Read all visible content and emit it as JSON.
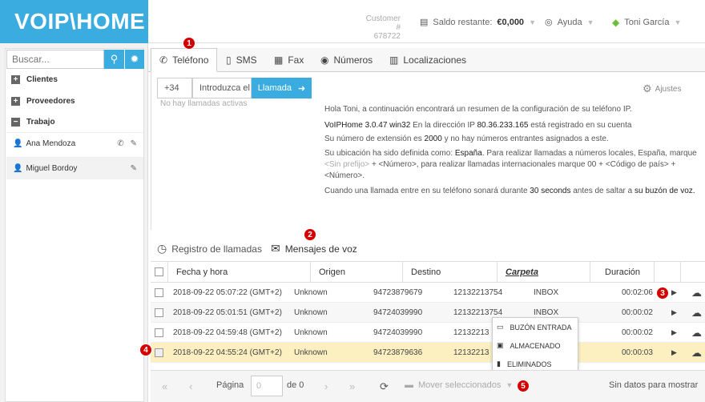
{
  "app": {
    "logo": "VOIP\\HOME"
  },
  "header": {
    "customer_label": "Customer #",
    "customer_number": "678722",
    "saldo_label": "Saldo restante:",
    "saldo_value": "€0,000",
    "help": "Ayuda",
    "user": "Toni García"
  },
  "sidebar": {
    "search_placeholder": "Buscar...",
    "groups": [
      {
        "label": "Clientes",
        "sign": "+"
      },
      {
        "label": "Proveedores",
        "sign": "+"
      },
      {
        "label": "Trabajo",
        "sign": "−"
      }
    ],
    "contacts": [
      "Ana Mendoza",
      "Miguel Bordoy"
    ]
  },
  "tabs": [
    "Teléfono",
    "SMS",
    "Fax",
    "Números",
    "Localizaciones"
  ],
  "dialer": {
    "prefix": "+34",
    "number_placeholder": "Introduzca el número",
    "call_label": "Llamada",
    "no_calls": "No hay llamadas activas",
    "settings": "Ajustes"
  },
  "info": {
    "greeting": "Hola Toni, a continuación encontrará un resumen de la configuración de su teléfono IP.",
    "version": "VoIPHome 3.0.47 win32",
    "ip_text": "En la dirección IP",
    "ip": "80.36.233.165",
    "registered": "está registrado en su cuenta",
    "ext_text": "Su número de extensión es",
    "ext": "2000",
    "ext_tail": "y no hay números entrantes asignados a este.",
    "loc_1": "Su ubicación ha sido definida como:",
    "loc_country": "España",
    "loc_2": ". Para realizar llamadas a números locales, España, marque",
    "loc_no_prefix": "<Sin prefijo>",
    "loc_3": "+ <Número>, para realizar llamadas internacionales marque 00 + <Código de país> +",
    "loc_4": "<Número>.",
    "call_1": "Cuando una llamada entre en su teléfono sonará durante",
    "call_secs": "30 seconds",
    "call_2": "antes de saltar a",
    "call_3": "su buzón de voz."
  },
  "lower_tabs": [
    "Registro de llamadas",
    "Mensajes de voz"
  ],
  "table": {
    "headers": [
      "Fecha y hora",
      "Origen",
      "Destino",
      "Carpeta",
      "Duración"
    ],
    "rows": [
      {
        "date": "2018-09-22 05:07:22 (GMT+2)",
        "origin": "Unknown",
        "from": "94723879679",
        "to": "12132213754",
        "folder": "INBOX",
        "duration": "00:02:06"
      },
      {
        "date": "2018-09-22 05:01:51 (GMT+2)",
        "origin": "Unknown",
        "from": "94724039990",
        "to": "12132213754",
        "folder": "INBOX",
        "duration": "00:00:02"
      },
      {
        "date": "2018-09-22 04:59:48 (GMT+2)",
        "origin": "Unknown",
        "from": "94724039990",
        "to": "12132213",
        "folder": "",
        "duration": "00:00:02"
      },
      {
        "date": "2018-09-22 04:55:24 (GMT+2)",
        "origin": "Unknown",
        "from": "94723879636",
        "to": "12132213",
        "folder": "",
        "duration": "00:00:03"
      }
    ]
  },
  "menu": [
    "BUZÓN ENTRADA",
    "ALMACENADO",
    "ELIMINADOS"
  ],
  "footer": {
    "page_label": "Página",
    "page_value": "0",
    "of_label": "de 0",
    "move_label": "Mover seleccionados",
    "no_data": "Sin datos para mostrar"
  },
  "badges": [
    "1",
    "2",
    "3",
    "4",
    "5"
  ],
  "colors": {
    "brand": "#3aace0",
    "badge": "#d40000",
    "selected_row": "#fcefc0"
  }
}
